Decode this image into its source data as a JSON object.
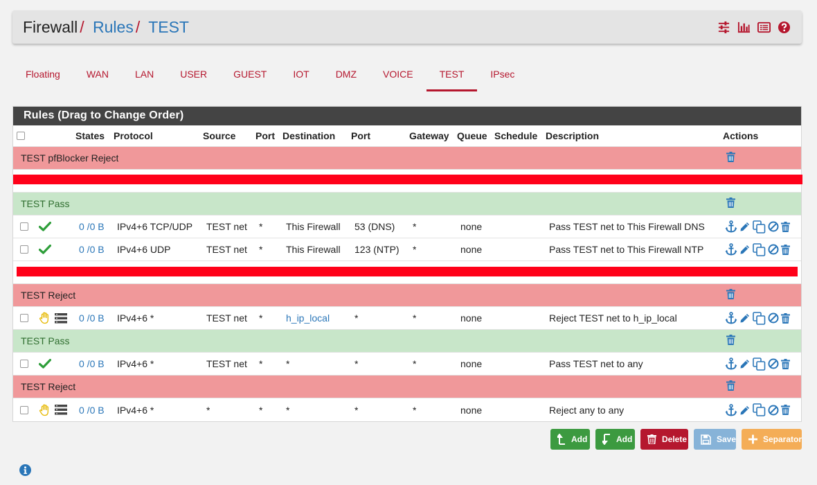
{
  "breadcrumb": {
    "root": "Firewall",
    "sep": "/",
    "rules": "Rules",
    "current": "TEST"
  },
  "tabs": [
    "Floating",
    "WAN",
    "LAN",
    "USER",
    "GUEST",
    "IOT",
    "DMZ",
    "VOICE",
    "TEST",
    "IPsec"
  ],
  "active_tab": "TEST",
  "panel": {
    "title": "Rules (Drag to Change Order)"
  },
  "columns": {
    "states": "States",
    "protocol": "Protocol",
    "source": "Source",
    "port": "Port",
    "destination": "Destination",
    "dport": "Port",
    "gateway": "Gateway",
    "queue": "Queue",
    "schedule": "Schedule",
    "description": "Description",
    "actions": "Actions"
  },
  "separators": {
    "s1": "TEST pfBlocker Reject",
    "s2": "TEST Pass",
    "s3": "TEST Reject",
    "s4": "TEST Pass",
    "s5": "TEST Reject"
  },
  "rules": {
    "r1": {
      "states": "0 /0 B",
      "protocol": "IPv4+6 TCP/UDP",
      "source": "TEST net",
      "port": "*",
      "destination": "This Firewall",
      "dport": "53 (DNS)",
      "gateway": "*",
      "queue": "none",
      "description": "Pass TEST net to This Firewall DNS"
    },
    "r2": {
      "states": "0 /0 B",
      "protocol": "IPv4+6 UDP",
      "source": "TEST net",
      "port": "*",
      "destination": "This Firewall",
      "dport": "123 (NTP)",
      "gateway": "*",
      "queue": "none",
      "description": "Pass TEST net to This Firewall NTP"
    },
    "r3": {
      "states": "0 /0 B",
      "protocol": "IPv4+6 *",
      "source": "TEST net",
      "port": "*",
      "destination": "h_ip_local",
      "dport": "*",
      "gateway": "*",
      "queue": "none",
      "description": "Reject TEST net to h_ip_local"
    },
    "r4": {
      "states": "0 /0 B",
      "protocol": "IPv4+6 *",
      "source": "TEST net",
      "port": "*",
      "destination": "*",
      "dport": "*",
      "gateway": "*",
      "queue": "none",
      "description": "Pass TEST net to any"
    },
    "r5": {
      "states": "0 /0 B",
      "protocol": "IPv4+6 *",
      "source": "*",
      "port": "*",
      "destination": "*",
      "dport": "*",
      "gateway": "*",
      "queue": "none",
      "description": "Reject any to any"
    }
  },
  "buttons": {
    "add_top": "Add",
    "add_bottom": "Add",
    "delete": "Delete",
    "save": "Save",
    "separator": "Separator"
  },
  "colors": {
    "accent": "#b5172e",
    "link": "#2a76b8",
    "pass": "#2e9e3a",
    "reject_sep": "#f0989a",
    "pass_sep": "#c8e6c9",
    "redaction": "#ff0019"
  }
}
